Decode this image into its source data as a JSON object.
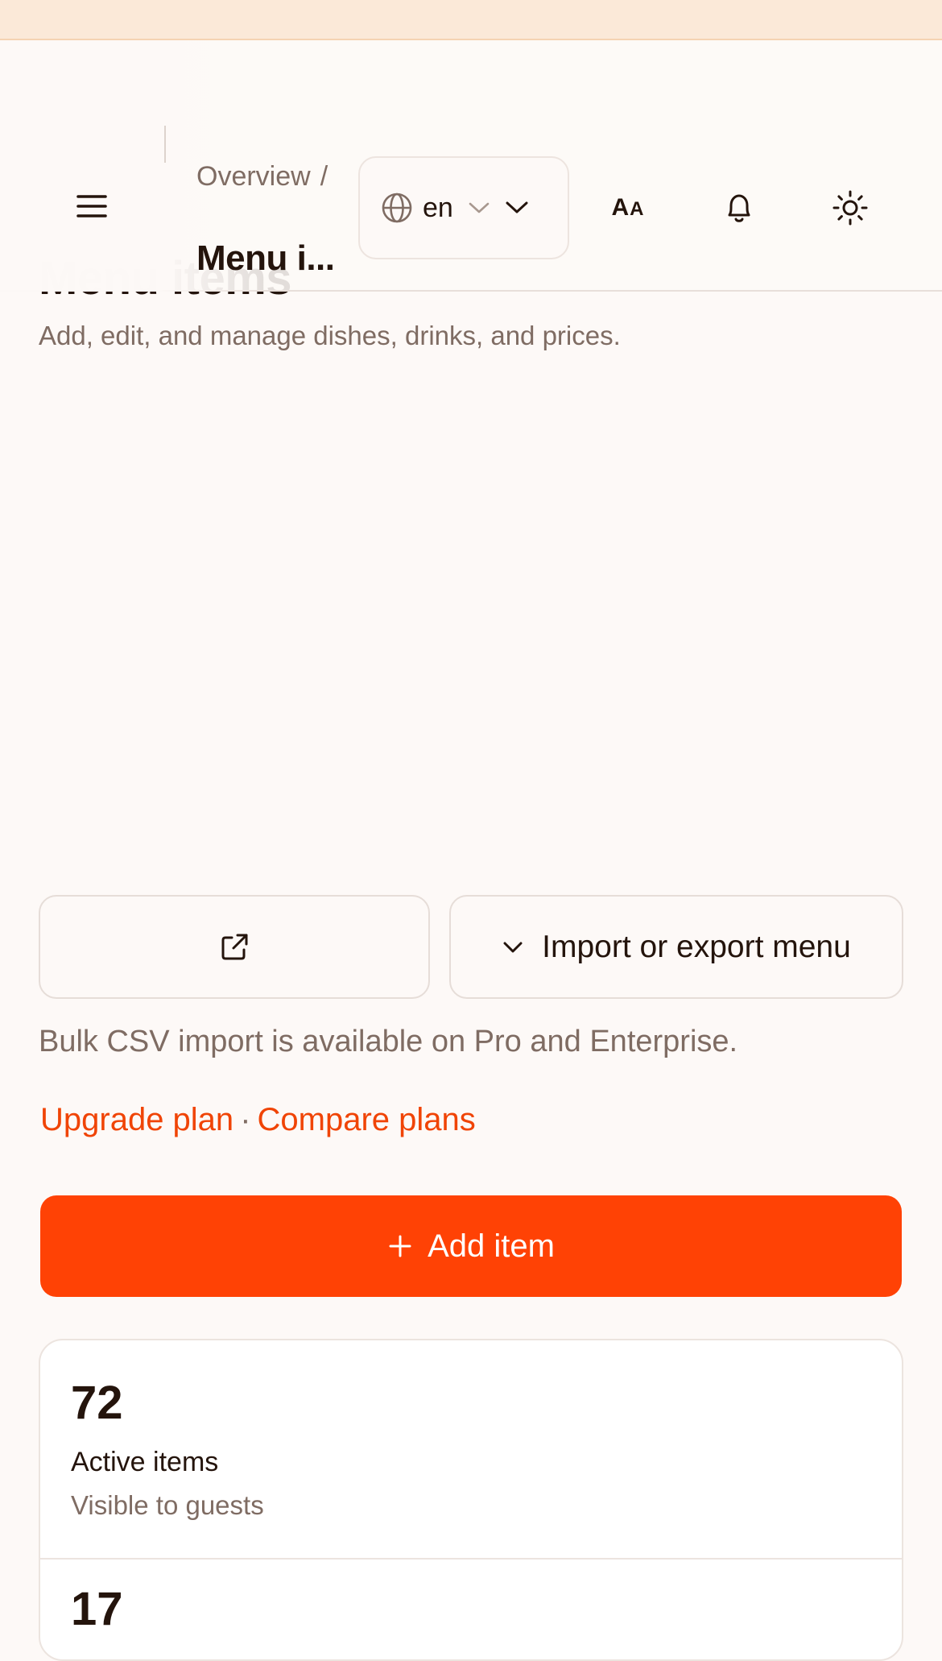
{
  "page": {
    "title": "Menu items",
    "subtitle": "Add, edit, and manage dishes, drinks, and prices."
  },
  "header": {
    "breadcrumb_parent": "Overview",
    "breadcrumb_separator": "/",
    "breadcrumb_current": "Menu i...",
    "language": "en",
    "text_size_icon": "text-size-icon",
    "notifications_icon": "bell-icon",
    "theme_icon": "sun-icon",
    "menu_icon": "hamburger-icon"
  },
  "actions": {
    "open_icon": "external-link-icon",
    "import_export_label": "Import or export menu",
    "import_note": "Bulk CSV import is available on Pro and Enterprise.",
    "upgrade_link": "Upgrade plan",
    "link_separator": "·",
    "compare_link": "Compare plans",
    "add_item_label": "Add item"
  },
  "stats": [
    {
      "value": "72",
      "label": "Active items",
      "description": "Visible to guests"
    },
    {
      "value": "17"
    }
  ],
  "colors": {
    "accent": "#ff4205",
    "link": "#f04406",
    "banner": "#fbe9d8",
    "background": "#fdf9f7",
    "text": "#24140c",
    "muted": "#7f6c63"
  }
}
